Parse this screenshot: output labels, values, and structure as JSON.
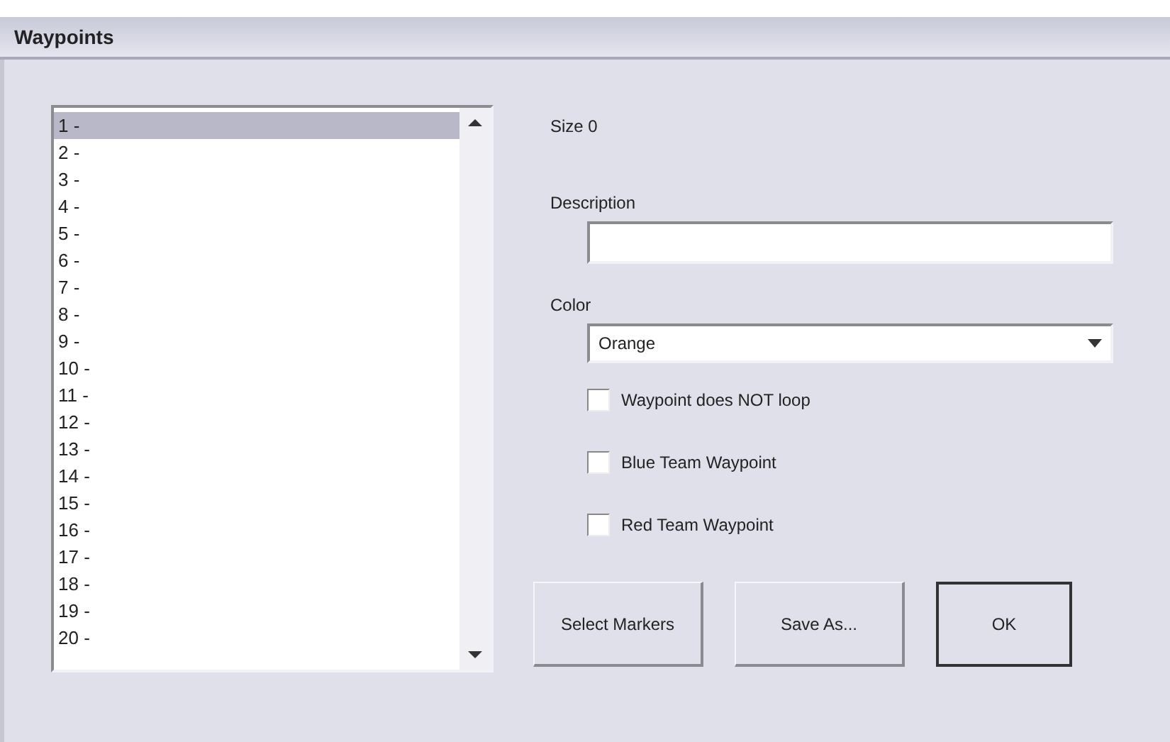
{
  "window": {
    "title": "Waypoints"
  },
  "waypoints": [
    {
      "label": "1 -",
      "selected": true
    },
    {
      "label": "2 -",
      "selected": false
    },
    {
      "label": "3 -",
      "selected": false
    },
    {
      "label": "4 -",
      "selected": false
    },
    {
      "label": "5 -",
      "selected": false
    },
    {
      "label": "6 -",
      "selected": false
    },
    {
      "label": "7 -",
      "selected": false
    },
    {
      "label": "8 -",
      "selected": false
    },
    {
      "label": "9 -",
      "selected": false
    },
    {
      "label": "10 -",
      "selected": false
    },
    {
      "label": "11 -",
      "selected": false
    },
    {
      "label": "12 -",
      "selected": false
    },
    {
      "label": "13 -",
      "selected": false
    },
    {
      "label": "14 -",
      "selected": false
    },
    {
      "label": "15 -",
      "selected": false
    },
    {
      "label": "16 -",
      "selected": false
    },
    {
      "label": "17 -",
      "selected": false
    },
    {
      "label": "18 -",
      "selected": false
    },
    {
      "label": "19 -",
      "selected": false
    },
    {
      "label": "20 -",
      "selected": false
    }
  ],
  "size": "Size 0",
  "description": {
    "label": "Description"
  },
  "color": {
    "label": "Color",
    "value": "Orange"
  },
  "options": [
    {
      "label": "Waypoint does NOT loop",
      "checked": false
    },
    {
      "label": "Blue Team Waypoint",
      "checked": false
    },
    {
      "label": "Red Team Waypoint",
      "checked": false
    }
  ],
  "buttons": [
    {
      "label": "Select Markers",
      "default": false
    },
    {
      "label": "Save As...",
      "default": false
    },
    {
      "label": "OK",
      "default": true
    }
  ]
}
